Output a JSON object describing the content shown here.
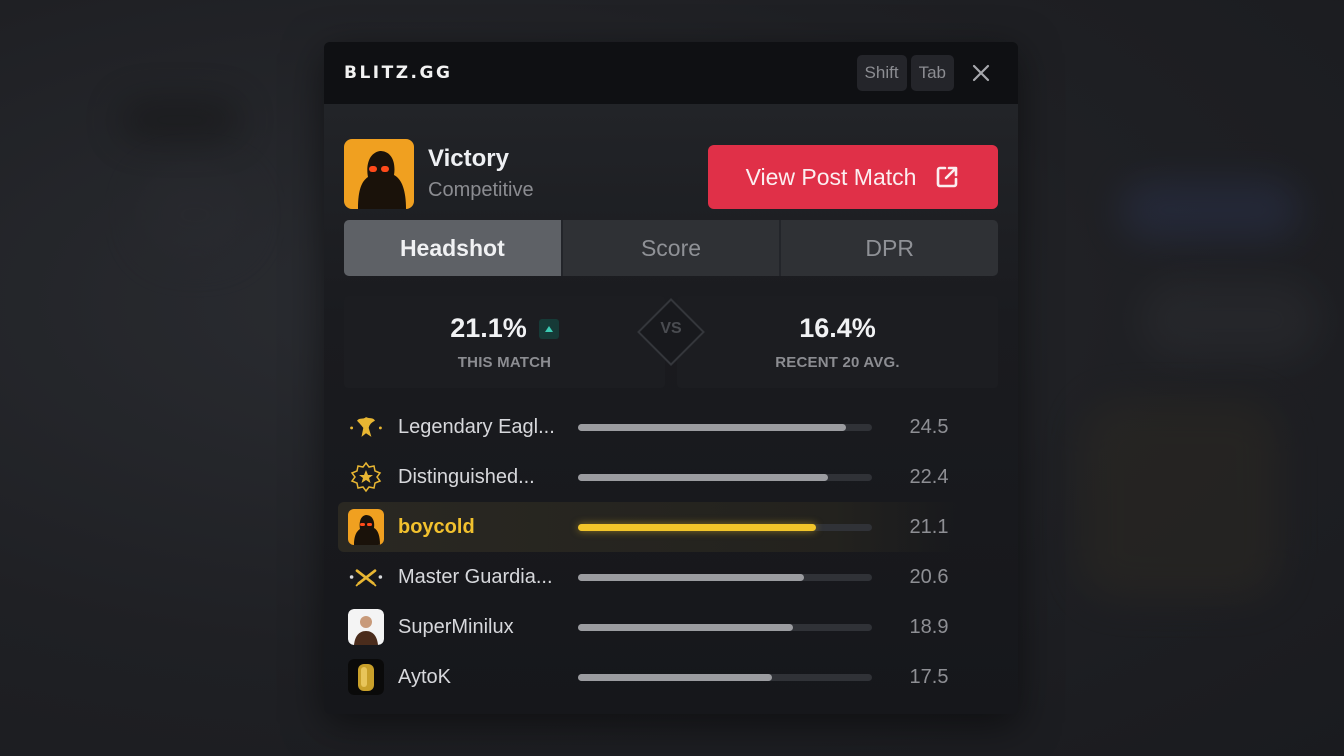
{
  "app": {
    "logo": "BLITZ.GG"
  },
  "hotkeys": [
    "Shift",
    "Tab"
  ],
  "header": {
    "result": "Victory",
    "mode": "Competitive",
    "post_match_button": "View Post Match"
  },
  "tabs": [
    {
      "label": "Headshot",
      "active": true
    },
    {
      "label": "Score",
      "active": false
    },
    {
      "label": "DPR",
      "active": false
    }
  ],
  "comparison": {
    "this_match": {
      "value": "21.1%",
      "label": "THIS MATCH",
      "trend": "up"
    },
    "vs_label": "VS",
    "recent": {
      "value": "16.4%",
      "label": "RECENT 20 AVG."
    }
  },
  "colors": {
    "accent_red": "#e03048",
    "highlight_yellow": "#f2c52a",
    "trend_up": "#3ccbb4"
  },
  "leaderboard": [
    {
      "icon": "legendary-eagle-rank-icon",
      "name": "Legendary Eagl...",
      "value": "24.5",
      "fill": 0.91,
      "me": false
    },
    {
      "icon": "distinguished-master-guardian-rank-icon",
      "name": "Distinguished...",
      "value": "22.4",
      "fill": 0.85,
      "me": false
    },
    {
      "icon": "player-avatar",
      "name": "boycold",
      "value": "21.1",
      "fill": 0.81,
      "me": true
    },
    {
      "icon": "master-guardian-rank-icon",
      "name": "Master Guardia...",
      "value": "20.6",
      "fill": 0.77,
      "me": false
    },
    {
      "icon": "player-avatar",
      "name": "SuperMinilux",
      "value": "18.9",
      "fill": 0.73,
      "me": false
    },
    {
      "icon": "player-avatar",
      "name": "AytoK",
      "value": "17.5",
      "fill": 0.66,
      "me": false
    }
  ]
}
